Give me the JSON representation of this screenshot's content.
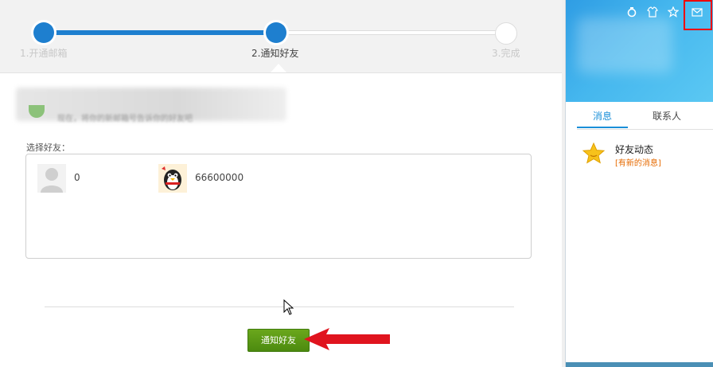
{
  "steps": [
    {
      "label": "1.开通邮箱",
      "state": "done"
    },
    {
      "label": "2.通知好友",
      "state": "current"
    },
    {
      "label": "3.完成",
      "state": "todo"
    }
  ],
  "intro_text": "现在，将你的新邮箱号告诉你的好友吧",
  "select_label": "选择好友：",
  "friends": [
    {
      "name": "0",
      "avatar": "default-avatar-icon"
    },
    {
      "name": "66600000",
      "avatar": "penguin-avatar-icon"
    }
  ],
  "notify_button": "通知好友",
  "colors": {
    "progress": "#1e7fcf",
    "button": "#5a9a16",
    "arrow": "#e0141e",
    "tab_active": "#1a8fd8",
    "notice": "#e66a00"
  },
  "qq_panel": {
    "tabs": [
      {
        "label": "消息",
        "active": true
      },
      {
        "label": "联系人",
        "active": false
      }
    ],
    "feed": {
      "title": "好友动态",
      "subtitle": "[有新的消息]"
    },
    "toolbar_icons": [
      "tools-icon",
      "shirt-icon",
      "star-icon",
      "mail-icon"
    ]
  }
}
